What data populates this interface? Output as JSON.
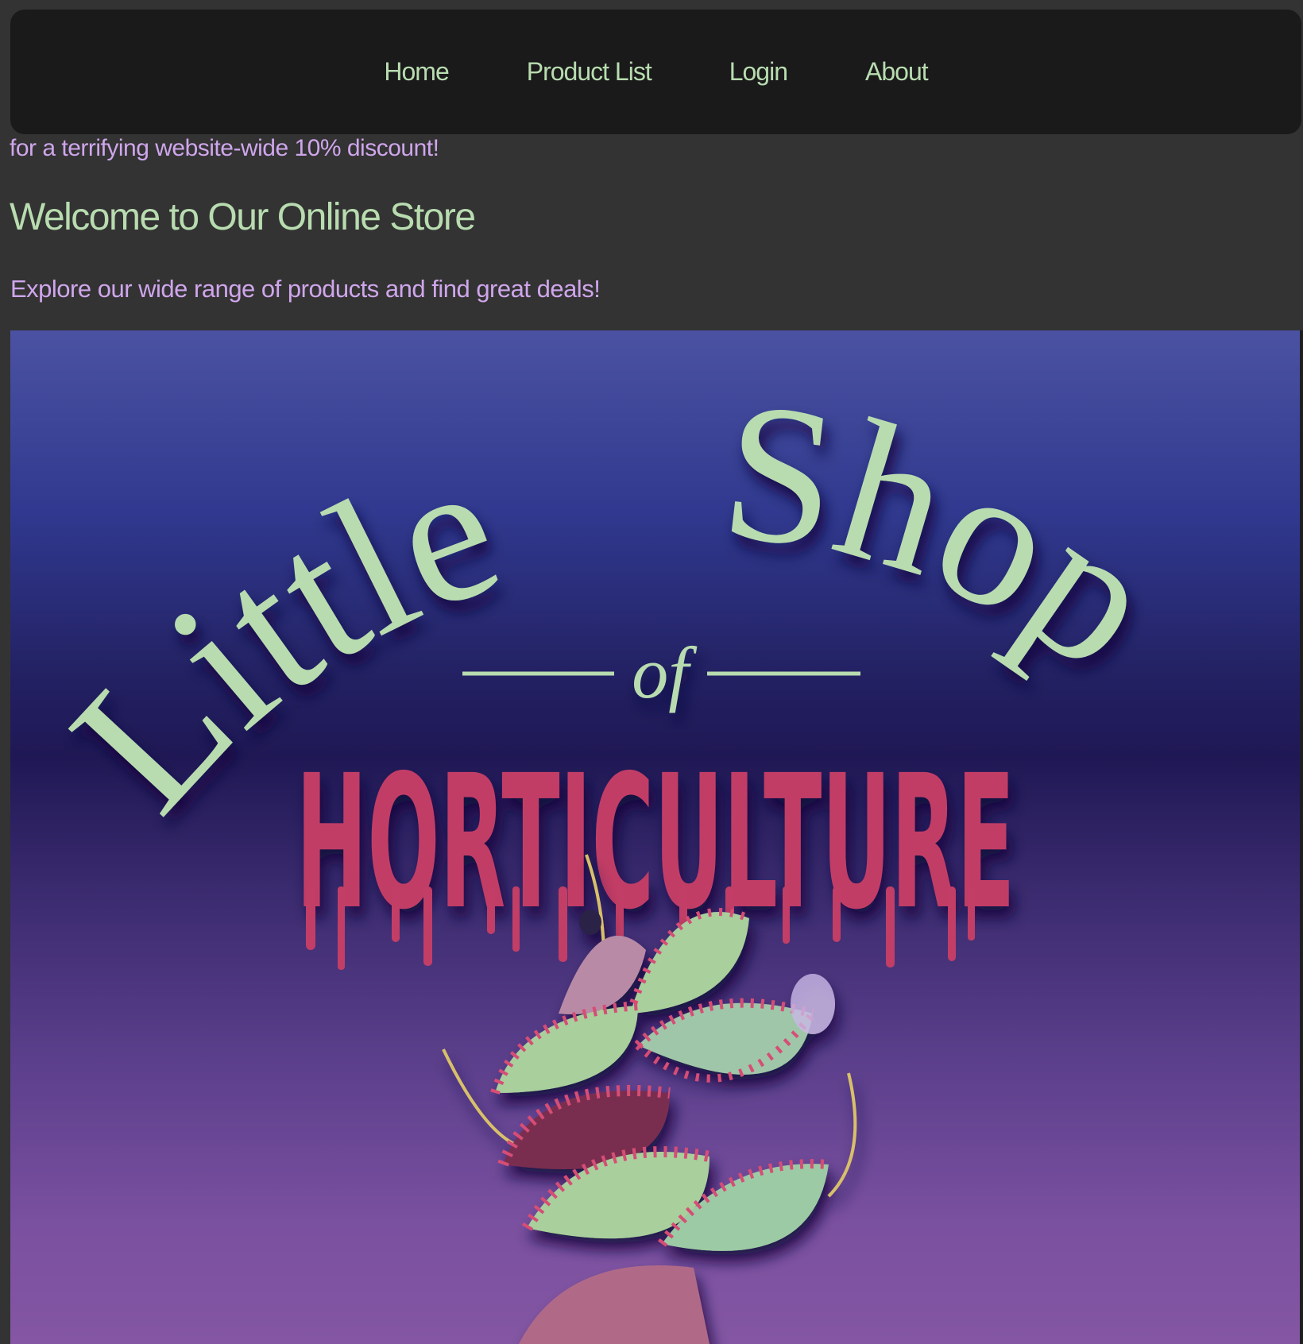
{
  "nav": {
    "items": [
      {
        "label": "Home"
      },
      {
        "label": "Product List"
      },
      {
        "label": "Login"
      },
      {
        "label": "About"
      }
    ]
  },
  "promo": {
    "text": "for a terrifying website-wide 10% discount!"
  },
  "hero": {
    "title": "Welcome to Our Online Store",
    "subtitle": "Explore our wide range of products and find great deals!"
  },
  "banner": {
    "logo_word_1": "Little",
    "logo_word_2": "Shop",
    "logo_connector": "of",
    "logo_word_3": "HORTICULTURE",
    "colors": {
      "logo_green": "#b8dcb0",
      "logo_red": "#c23e66",
      "gradient_top": "#4b52a2",
      "gradient_bottom": "#8456a3"
    }
  }
}
